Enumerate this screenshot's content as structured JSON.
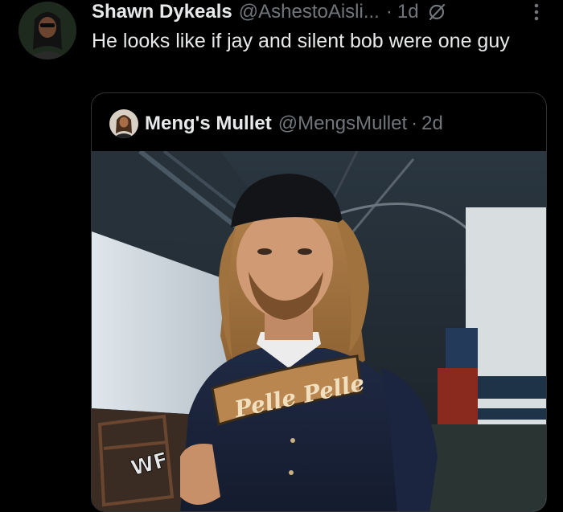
{
  "tweet": {
    "author": {
      "display_name": "Shawn Dykeals",
      "handle": "@AshestoAisli...",
      "avatar_icon": "avatar-icon"
    },
    "separator": "·",
    "time": "1d",
    "text": "He looks like if jay and silent bob were one guy",
    "icons": [
      "grok-icon",
      "more-icon"
    ]
  },
  "quoted_tweet": {
    "author": {
      "display_name": "Meng's Mullet",
      "handle": "@MengsMullet",
      "avatar_icon": "avatar-icon"
    },
    "separator": "·",
    "time": "2d",
    "media": {
      "description_icon": "photo",
      "shirt_text": "Pelle Pelle",
      "watermark": "WF"
    }
  },
  "colors": {
    "background": "#000000",
    "text_primary": "#e7e9ea",
    "text_secondary": "#71767b",
    "border": "#2f3336"
  }
}
